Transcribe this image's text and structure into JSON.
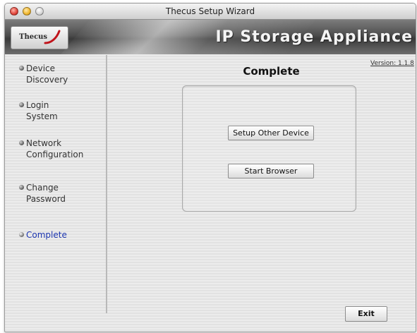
{
  "window": {
    "title": "Thecus Setup Wizard"
  },
  "banner": {
    "logo_text": "Thecus",
    "title": "IP Storage Appliance"
  },
  "sidebar": {
    "items": [
      {
        "line1": "Device",
        "line2": "Discovery"
      },
      {
        "line1": "Login",
        "line2": "System"
      },
      {
        "line1": "Network",
        "line2": "Configuration"
      },
      {
        "line1": "Change",
        "line2": "Password"
      },
      {
        "line1": "Complete",
        "line2": ""
      }
    ],
    "active_item": "Complete"
  },
  "main": {
    "title": "Complete",
    "version": "Version: 1.1.8",
    "setup_other_device_label": "Setup Other Device",
    "start_browser_label": "Start Browser",
    "exit_label": "Exit"
  },
  "colors": {
    "active_nav_text": "#1c36b0",
    "logo_swoosh": "#c0141b"
  }
}
